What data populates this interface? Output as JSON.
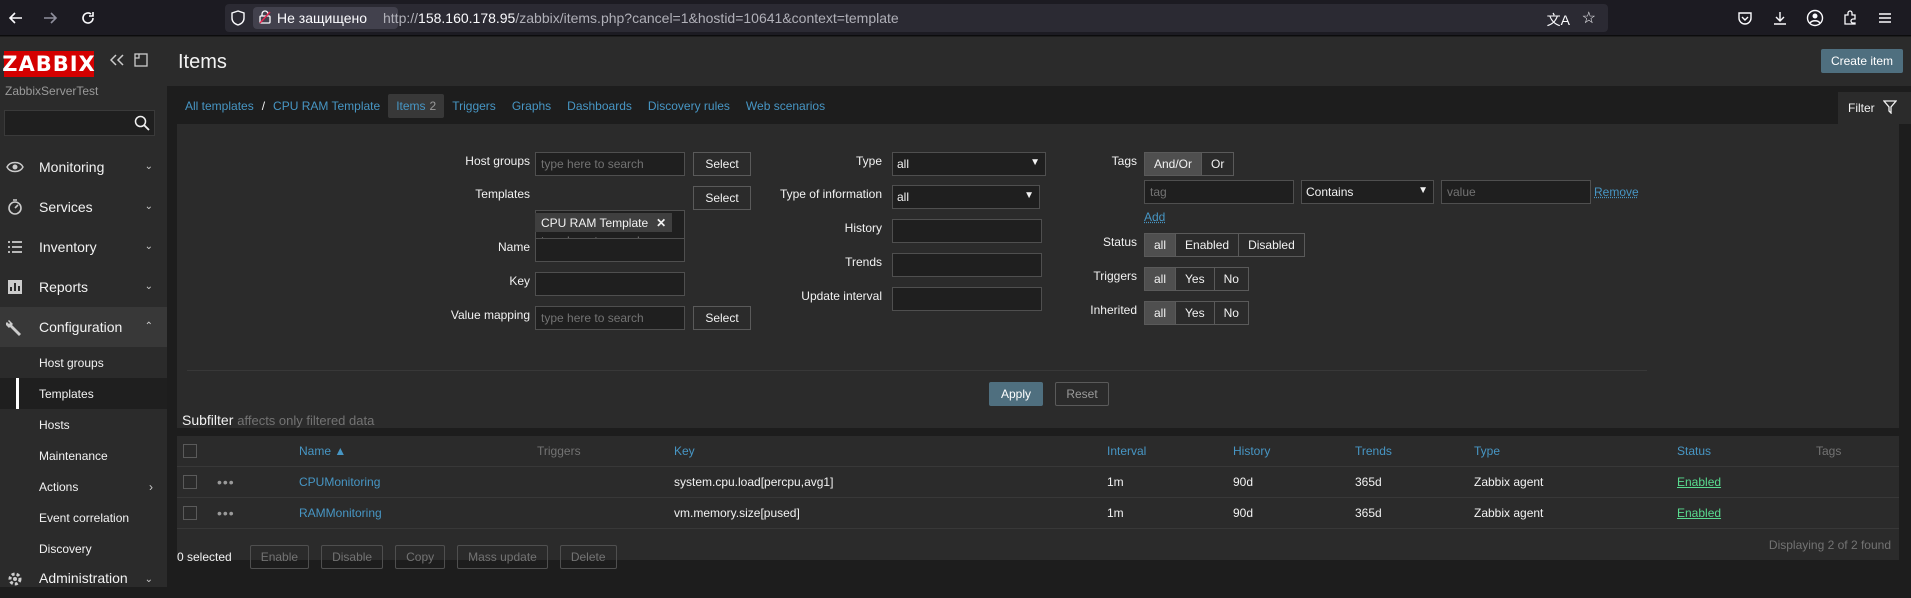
{
  "browser": {
    "security_label": "Не защищено",
    "url_prefix": "http://",
    "url_host": "158.160.178.95",
    "url_rest": "/zabbix/items.php?cancel=1&hostid=10641&context=template"
  },
  "sidebar": {
    "logo": "ZABBIX",
    "server_name": "ZabbixServerTest",
    "menu": [
      {
        "label": "Monitoring",
        "icon": "eye-icon"
      },
      {
        "label": "Services",
        "icon": "services-icon"
      },
      {
        "label": "Inventory",
        "icon": "list-icon"
      },
      {
        "label": "Reports",
        "icon": "chart-icon"
      },
      {
        "label": "Configuration",
        "icon": "wrench-icon"
      }
    ],
    "submenu": [
      "Host groups",
      "Templates",
      "Hosts",
      "Maintenance",
      "Actions",
      "Event correlation",
      "Discovery"
    ],
    "admin_label": "Administration"
  },
  "header": {
    "title": "Items",
    "create_label": "Create item"
  },
  "nav": {
    "all_templates": "All templates",
    "separator": "/",
    "template": "CPU RAM Template",
    "items": "Items",
    "items_count": "2",
    "triggers": "Triggers",
    "graphs": "Graphs",
    "dashboards": "Dashboards",
    "discovery": "Discovery rules",
    "web": "Web scenarios"
  },
  "filter": {
    "tab_label": "Filter",
    "host_groups_label": "Host groups",
    "templates_label": "Templates",
    "name_label": "Name",
    "key_label": "Key",
    "value_mapping_label": "Value mapping",
    "search_placeholder": "type here to search",
    "select_label": "Select",
    "template_chip": "CPU RAM Template",
    "type_label": "Type",
    "type_value": "all",
    "type_info_label": "Type of information",
    "type_info_value": "all",
    "history_label": "History",
    "trends_label": "Trends",
    "update_interval_label": "Update interval",
    "tags_label": "Tags",
    "and_or": "And/Or",
    "or": "Or",
    "tag_placeholder": "tag",
    "contains": "Contains",
    "value_placeholder": "value",
    "remove": "Remove",
    "add": "Add",
    "status_label": "Status",
    "status_opts": [
      "all",
      "Enabled",
      "Disabled"
    ],
    "triggers_label": "Triggers",
    "inherited_label": "Inherited",
    "yn_opts": [
      "all",
      "Yes",
      "No"
    ],
    "apply": "Apply",
    "reset": "Reset",
    "subfilter": "Subfilter",
    "subfilter_note": "affects only filtered data"
  },
  "table": {
    "headers": {
      "name": "Name ▲",
      "triggers": "Triggers",
      "key": "Key",
      "interval": "Interval",
      "history": "History",
      "trends": "Trends",
      "type": "Type",
      "status": "Status",
      "tags": "Tags"
    },
    "rows": [
      {
        "name": "CPUMonitoring",
        "key": "system.cpu.load[percpu,avg1]",
        "interval": "1m",
        "history": "90d",
        "trends": "365d",
        "type": "Zabbix agent",
        "status": "Enabled"
      },
      {
        "name": "RAMMonitoring",
        "key": "vm.memory.size[pused]",
        "interval": "1m",
        "history": "90d",
        "trends": "365d",
        "type": "Zabbix agent",
        "status": "Enabled"
      }
    ],
    "footer": "Displaying 2 of 2 found"
  },
  "actions": {
    "selected": "0 selected",
    "buttons": [
      "Enable",
      "Disable",
      "Copy",
      "Mass update",
      "Delete"
    ]
  }
}
